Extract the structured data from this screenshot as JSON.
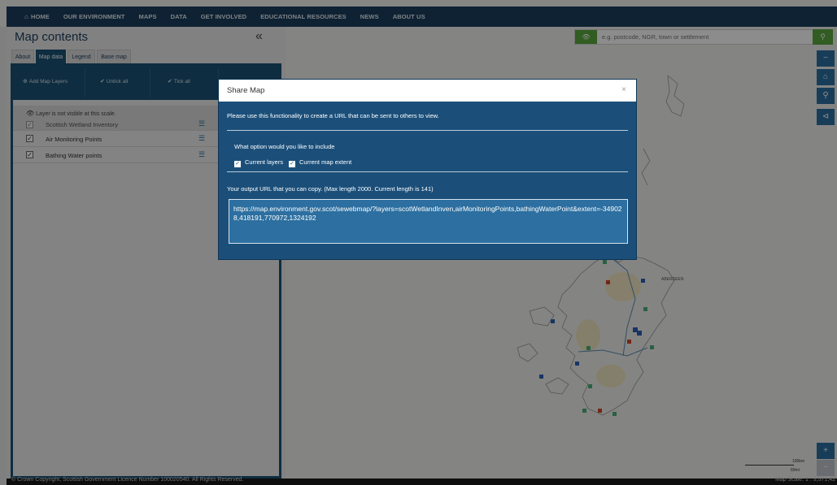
{
  "nav": {
    "items": [
      "HOME",
      "OUR ENVIRONMENT",
      "MAPS",
      "DATA",
      "GET INVOLVED",
      "EDUCATIONAL RESOURCES",
      "NEWS",
      "ABOUT US"
    ]
  },
  "panel": {
    "title": "Map contents",
    "collapse": "«",
    "tabs": [
      "About",
      "Map data",
      "Legend",
      "Base map"
    ],
    "active_tab": "Map data",
    "toolbar": {
      "add": "Add Map Layers",
      "untick": "Untick all",
      "tick": "Tick all"
    },
    "warning": "Layer is not visible at this scale.",
    "layers": [
      {
        "name": "Scottish Wetland Inventory",
        "checked": true
      },
      {
        "name": "Air Monitoring Points",
        "checked": true
      },
      {
        "name": "Bathing Water points",
        "checked": true
      }
    ]
  },
  "search": {
    "placeholder": "e.g. postcode, NGR, town or settlement"
  },
  "map": {
    "place_labels": [
      "ABERDEEN"
    ],
    "scale": {
      "km": "100km",
      "mi": "60mi"
    }
  },
  "footer": {
    "copyright": "© Crown Copyright, Scottish Government Licence Number 100020540. All Rights Reserved.",
    "scale": "Map Scale: 1 : 3,571,42"
  },
  "modal": {
    "title": "Share Map",
    "close": "×",
    "description": "Please use this functionality to create a URL that can be sent to others to view.",
    "option_label": "What option would you like to include",
    "options": [
      {
        "label": "Current layers",
        "checked": true
      },
      {
        "label": "Current map extent",
        "checked": true
      }
    ],
    "output_label": "Your output URL that you can copy. (Max length 2000. Current length is 141)",
    "output_url": "https://map.environment.gov.scot/sewebmap/?layers=scotWetlandInven,airMonitoringPoints,bathingWaterPoint&extent=-349028,418191,770972,1324192"
  },
  "colors": {
    "nav_bg": "#1b3f5e",
    "accent_blue": "#1b5276",
    "modal_bg": "#1b4f7a",
    "green": "#5aa83f",
    "map_button": "#2c6fa0"
  }
}
